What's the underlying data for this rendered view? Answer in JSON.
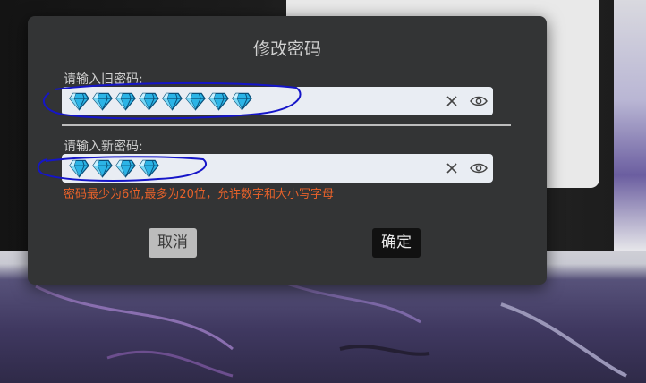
{
  "dialog": {
    "title": "修改密码",
    "old_password": {
      "label": "请输入旧密码:",
      "mask_count": 8
    },
    "new_password": {
      "label": "请输入新密码:",
      "mask_count": 4
    },
    "hint": "密码最少为6位,最多为20位，允许数字和大小写字母",
    "cancel_label": "取消",
    "confirm_label": "确定"
  },
  "icons": {
    "mask_glyph": "gem-icon",
    "clear": "close-icon",
    "reveal": "eye-icon"
  },
  "colors": {
    "dialog_bg": "#333435",
    "field_bg": "#e9edf3",
    "hint": "#e8622a",
    "scribble": "#1515c8"
  }
}
